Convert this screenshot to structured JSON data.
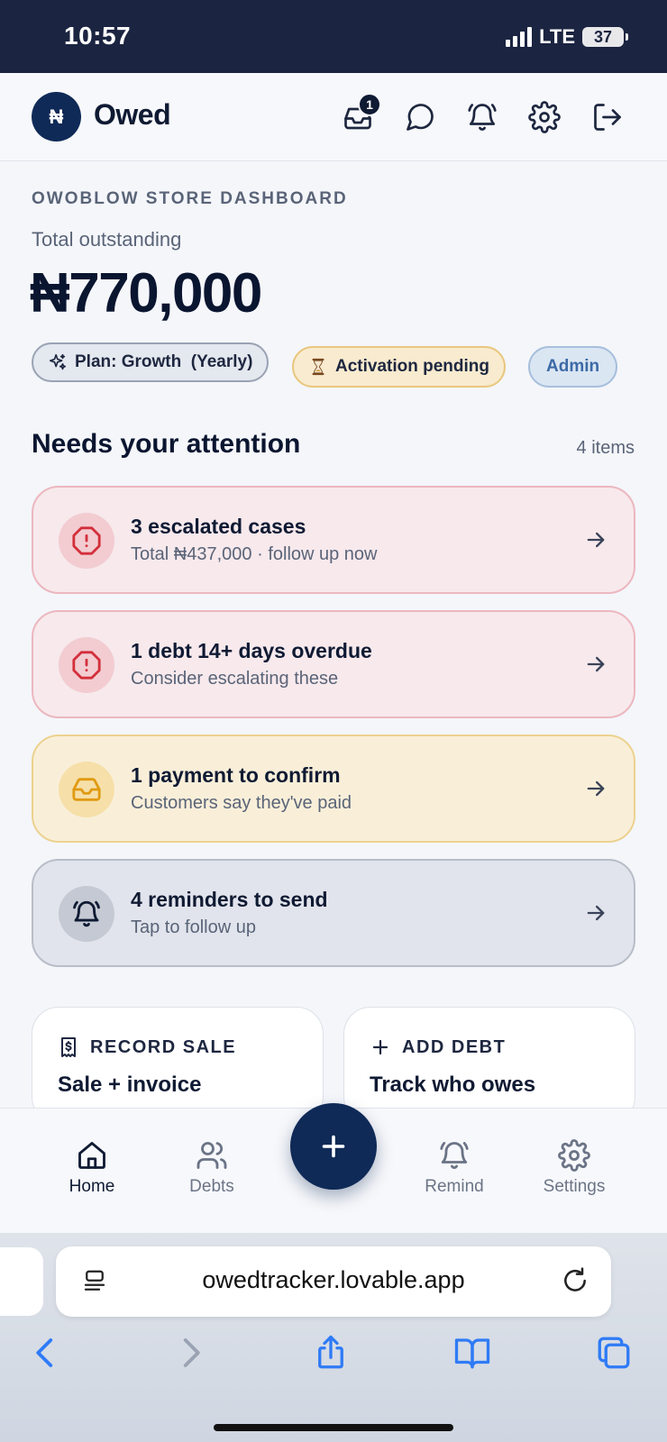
{
  "status_bar": {
    "time": "10:57",
    "network": "LTE",
    "battery": "37"
  },
  "header": {
    "logo_symbol": "₦",
    "brand": "Owed",
    "inbox_badge": "1"
  },
  "dashboard": {
    "store_label": "OWOBLOW STORE DASHBOARD",
    "total_label": "Total outstanding",
    "total_amount": "₦770,000",
    "plan_pill": "Plan: Growth  (Yearly)",
    "activation_pill": "Activation pending",
    "role_pill": "Admin"
  },
  "attention": {
    "title": "Needs your attention",
    "count": "4 items",
    "items": [
      {
        "title": "3 escalated cases",
        "subtitle": "Total ₦437,000 · follow up now",
        "icon": "alert-octagon-icon"
      },
      {
        "title": "1 debt 14+ days overdue",
        "subtitle": "Consider escalating these",
        "icon": "alert-octagon-icon"
      },
      {
        "title": "1 payment to confirm",
        "subtitle": "Customers say they've paid",
        "icon": "inbox-icon"
      },
      {
        "title": "4 reminders to send",
        "subtitle": "Tap to follow up",
        "icon": "bell-icon"
      }
    ]
  },
  "quick_actions": [
    {
      "label": "RECORD SALE",
      "title": "Sale + invoice",
      "icon": "receipt-icon"
    },
    {
      "label": "ADD DEBT",
      "title": "Track who owes",
      "icon": "plus-icon"
    }
  ],
  "bottom_nav": [
    {
      "label": "Home",
      "icon": "home-icon",
      "active": true
    },
    {
      "label": "Debts",
      "icon": "users-icon",
      "active": false
    },
    {
      "label": "Remind",
      "icon": "bell-ring-icon",
      "active": false
    },
    {
      "label": "Settings",
      "icon": "gear-icon",
      "active": false
    }
  ],
  "browser": {
    "url": "owedtracker.lovable.app"
  },
  "colors": {
    "primary": "#0f2a57",
    "danger_bg": "#f7e9ec",
    "warning_bg": "#f9efd9",
    "neutral_bg": "#e1e4ec"
  }
}
